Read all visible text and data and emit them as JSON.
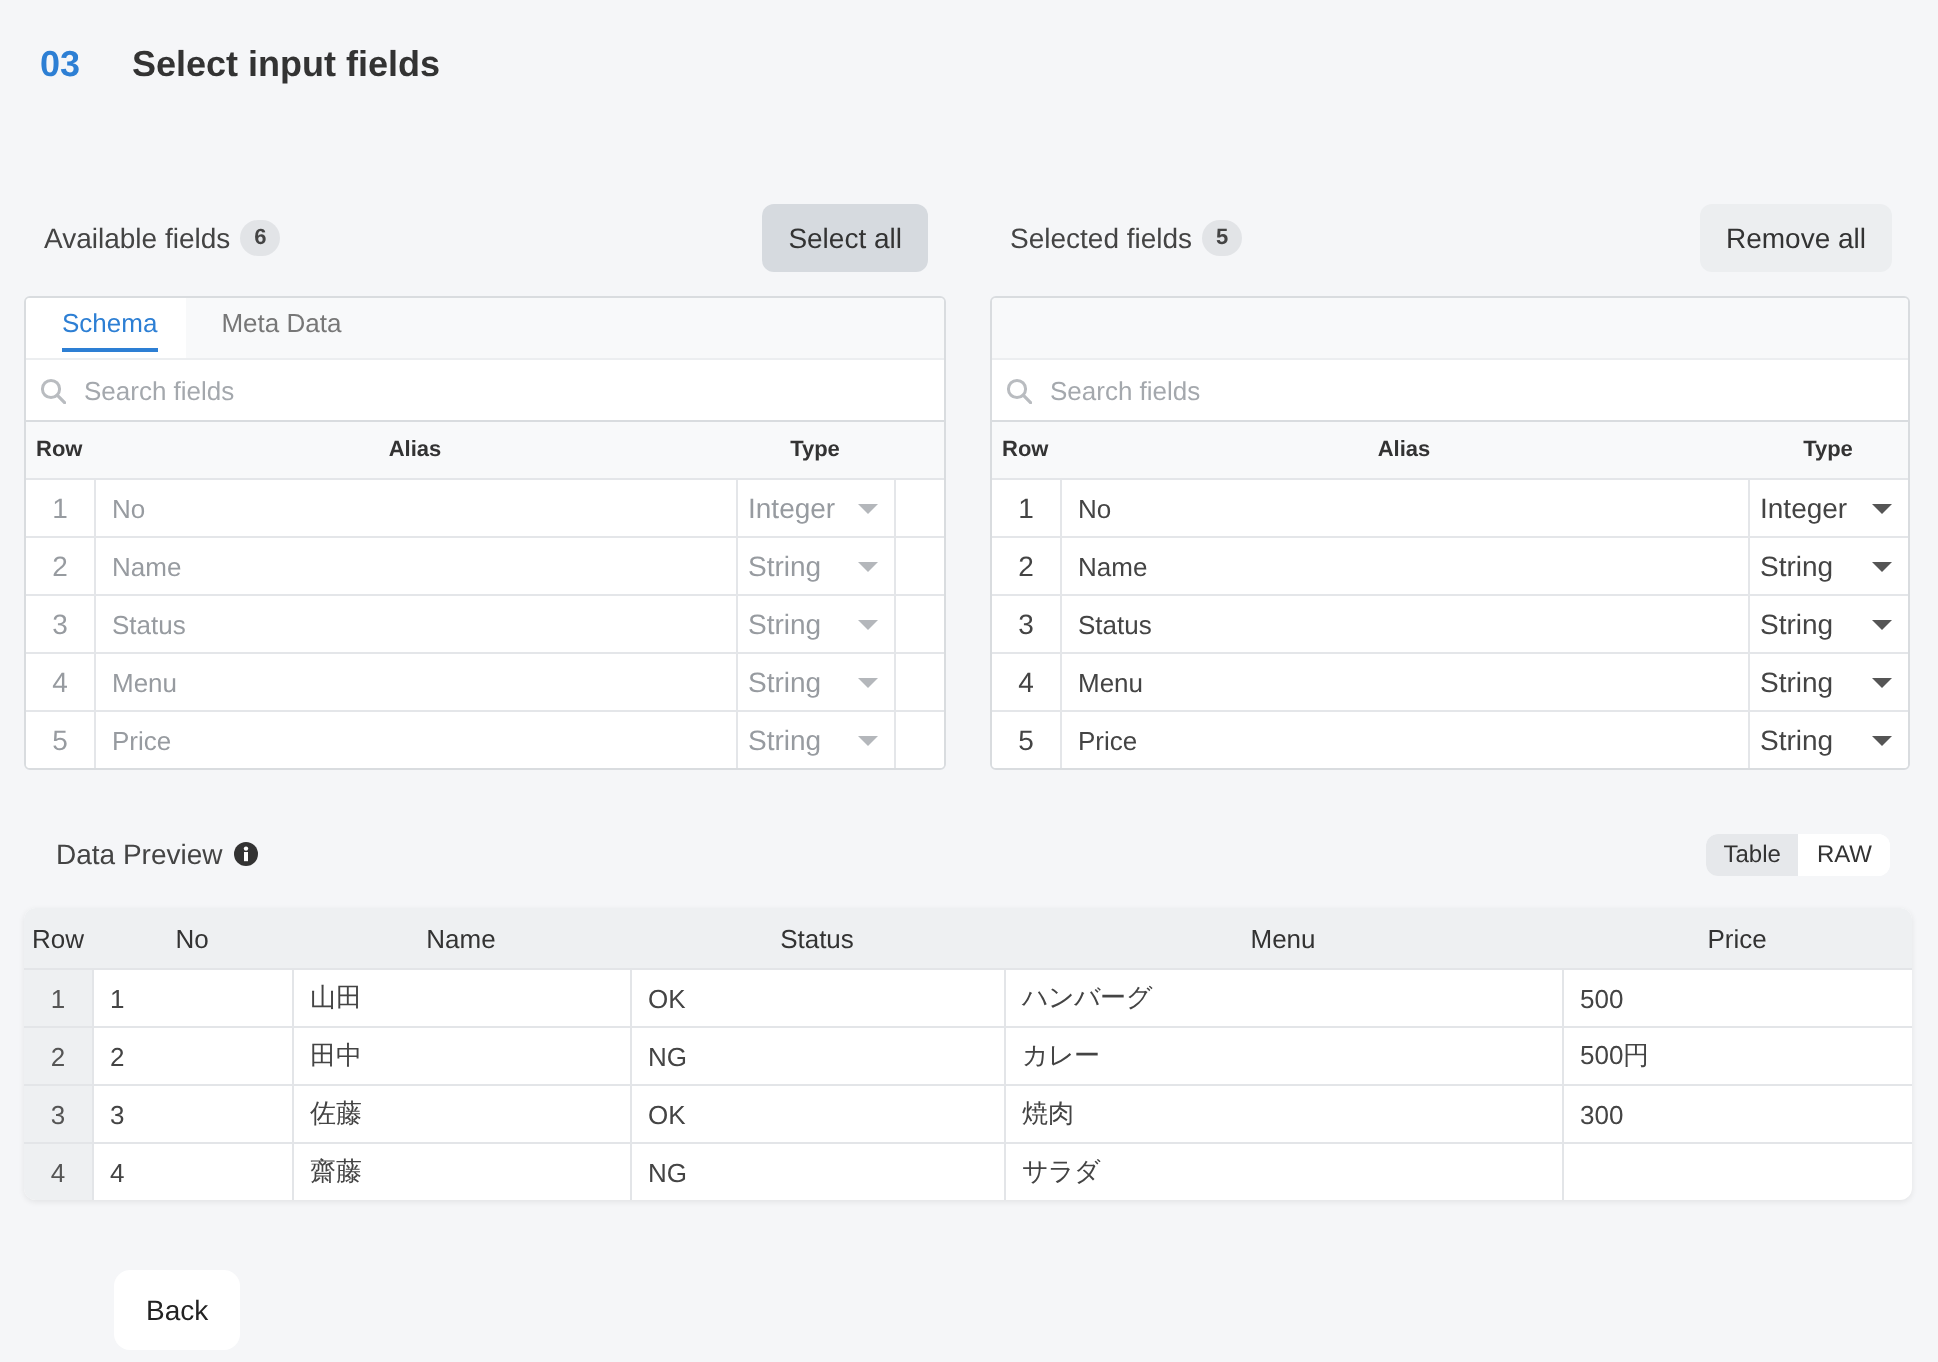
{
  "step": {
    "number": "03",
    "title": "Select input fields"
  },
  "panels": [
    {
      "label": "Available fields",
      "count": "6",
      "button": {
        "label": "Select all",
        "hovered": true
      },
      "tabs": [
        {
          "label": "Schema",
          "selected": true
        },
        {
          "label": "Meta Data",
          "selected": false
        }
      ],
      "search": {
        "placeholder": "Search fields"
      },
      "columns": [
        "Row",
        "Alias",
        "Type"
      ],
      "rows": [
        {
          "row": "1",
          "alias": "No",
          "type": "Integer",
          "disabled": true
        },
        {
          "row": "2",
          "alias": "Name",
          "type": "String",
          "disabled": true
        },
        {
          "row": "3",
          "alias": "Status",
          "type": "String",
          "disabled": true
        },
        {
          "row": "4",
          "alias": "Menu",
          "type": "String",
          "disabled": true
        },
        {
          "row": "5",
          "alias": "Price",
          "type": "String",
          "disabled": true
        }
      ]
    },
    {
      "label": "Selected fields",
      "count": "5",
      "button": {
        "label": "Remove all",
        "hovered": false
      },
      "search": {
        "placeholder": "Search fields"
      },
      "columns": [
        "Row",
        "Alias",
        "Type"
      ],
      "rows": [
        {
          "row": "1",
          "alias": "No",
          "type": "Integer",
          "disabled": false
        },
        {
          "row": "2",
          "alias": "Name",
          "type": "String",
          "disabled": false
        },
        {
          "row": "3",
          "alias": "Status",
          "type": "String",
          "disabled": false
        },
        {
          "row": "4",
          "alias": "Menu",
          "type": "String",
          "disabled": false
        },
        {
          "row": "5",
          "alias": "Price",
          "type": "String",
          "disabled": false
        }
      ]
    }
  ],
  "preview": {
    "label": "Data Preview",
    "views": [
      {
        "label": "Table",
        "selected": true
      },
      {
        "label": "RAW",
        "selected": false
      }
    ],
    "columns": [
      "Row",
      "No",
      "Name",
      "Status",
      "Menu",
      "Price"
    ],
    "rows": [
      {
        "row": "1",
        "cells": [
          "1",
          "山田",
          "OK",
          "ハンバーグ",
          "500"
        ]
      },
      {
        "row": "2",
        "cells": [
          "2",
          "田中",
          "NG",
          "カレー",
          "500円"
        ]
      },
      {
        "row": "3",
        "cells": [
          "3",
          "佐藤",
          "OK",
          "焼肉",
          "300"
        ]
      },
      {
        "row": "4",
        "cells": [
          "4",
          "齋藤",
          "NG",
          "サラダ"
        ]
      }
    ]
  },
  "back_button": "Back"
}
